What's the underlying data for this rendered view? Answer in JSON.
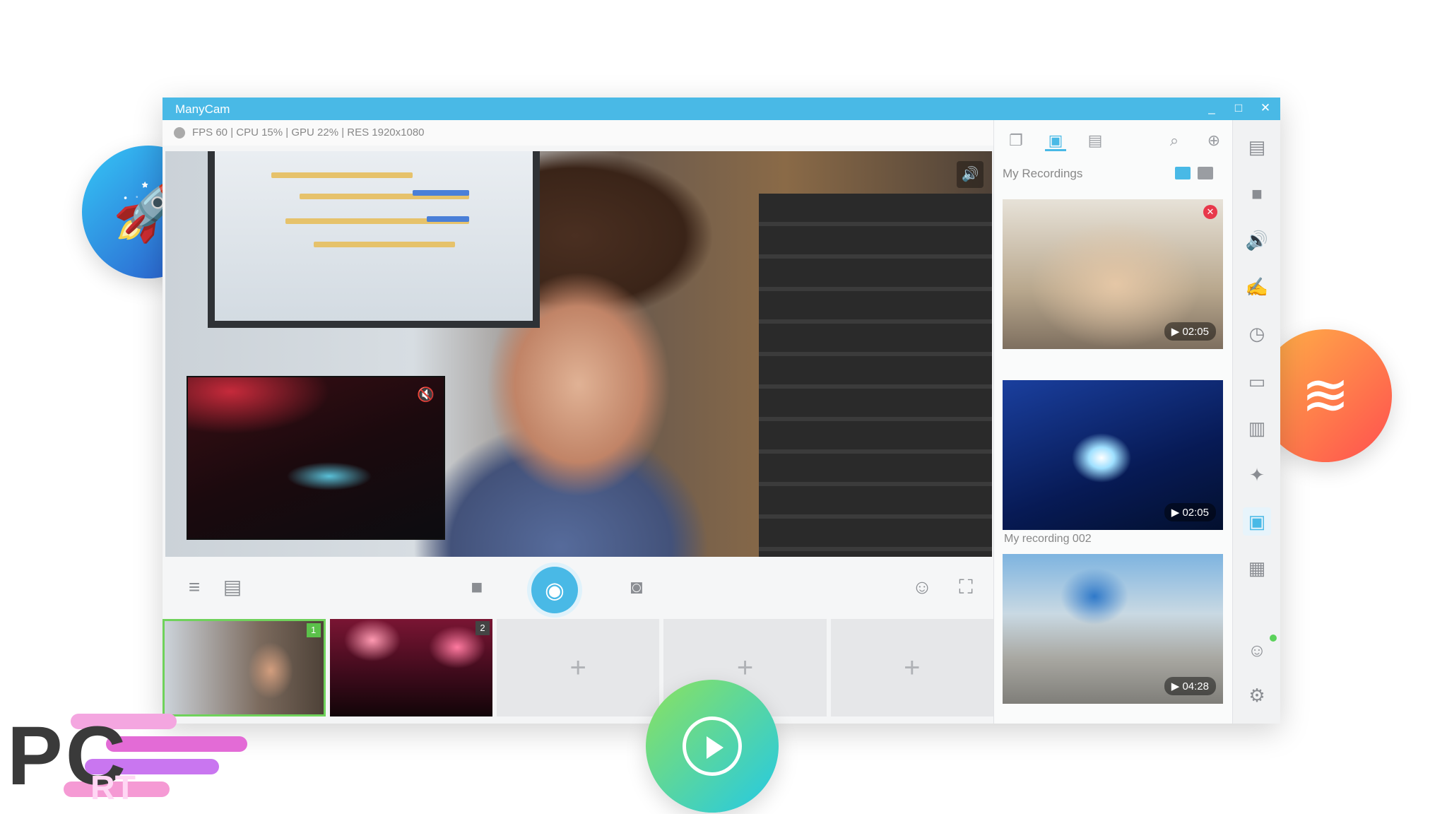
{
  "app": {
    "title": "ManyCam"
  },
  "status": {
    "text": "FPS 60 | CPU 15% | GPU 22% | RES 1920x1080"
  },
  "window_controls": [
    "minimize",
    "maximize",
    "close"
  ],
  "toolbar": {
    "icons": [
      "playlist-icon",
      "layout-icon",
      "video-icon",
      "broadcast-icon",
      "camera-icon",
      "mask-icon",
      "fullscreen-icon"
    ]
  },
  "presets": [
    {
      "number": "1",
      "state": "active"
    },
    {
      "number": "2",
      "state": "filled"
    },
    {
      "plus": "+"
    },
    {
      "plus": "+"
    },
    {
      "plus": "+"
    }
  ],
  "right_panel": {
    "header": "My Recordings",
    "recordings": [
      {
        "label": "",
        "duration": "02:05"
      },
      {
        "label": "My recording 002",
        "duration": "02:05"
      },
      {
        "label": "",
        "duration": "04:28"
      }
    ]
  },
  "sidebar": {
    "items": [
      "presets",
      "video",
      "audio",
      "drawing",
      "time",
      "lower-thirds",
      "layers",
      "effects",
      "media",
      "widgets",
      "account",
      "settings"
    ],
    "active": "media"
  },
  "colors": {
    "accent": "#49b9e6",
    "active_preset": "#6fd25b",
    "delete": "#e8384a"
  },
  "watermark": {
    "text_main": "PC",
    "text_sub": "RT"
  }
}
